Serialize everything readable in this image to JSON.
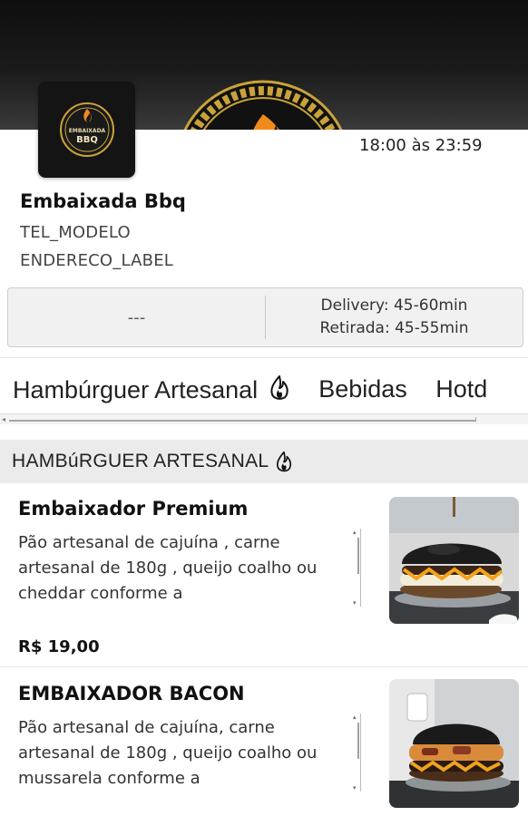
{
  "store": {
    "hours": "18:00 às 23:59",
    "name": "Embaixada Bbq",
    "phone": "TEL_MODELO",
    "address": "ENDERECO_LABEL",
    "logo_text_top": "EMBAIXADA",
    "logo_text_bottom": "BBQ"
  },
  "info": {
    "left": "---",
    "delivery": "Delivery: 45-60min",
    "pickup": "Retirada: 45-55min"
  },
  "tabs": [
    {
      "label": "Hambúrguer Artesanal",
      "icon": "flame-icon"
    },
    {
      "label": "Bebidas"
    },
    {
      "label": "Hotd"
    }
  ],
  "section": {
    "title": "HAMBúRGUER ARTESANAL",
    "icon": "flame-icon"
  },
  "products": [
    {
      "name": "Embaixador Premium",
      "description": "Pão artesanal de cajuína , carne artesanal de 180g , queijo coalho ou cheddar conforme a",
      "price": "R$ 19,00",
      "image": "burger-photo"
    },
    {
      "name": "EMBAIXADOR BACON",
      "description": "Pão artesanal de cajuína, carne artesanal de 180g , queijo coalho ou mussarela conforme a",
      "image": "burger-photo"
    }
  ],
  "colors": {
    "banner_dark": "#0e0e0e",
    "gold": "#c9a23a",
    "flame": "#f08a1c",
    "section_bg": "#ebebeb"
  }
}
